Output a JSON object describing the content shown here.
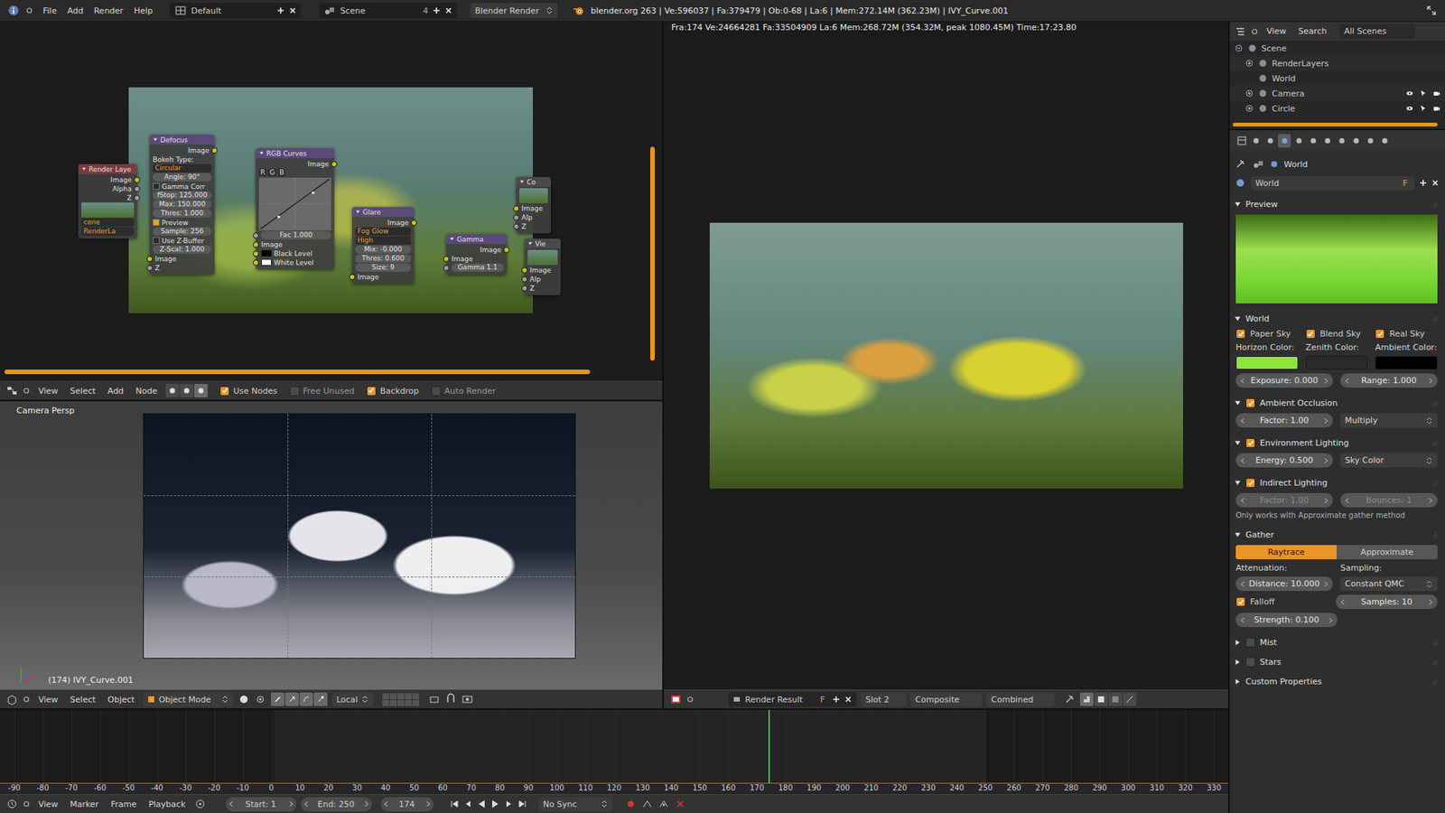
{
  "top_bar": {
    "menus": [
      "File",
      "Add",
      "Render",
      "Help"
    ],
    "screen_layout": "Default",
    "scene": "Scene",
    "scene_users": "4",
    "render_engine": "Blender Render",
    "stats": "blender.org 263 | Ve:596037 | Fa:379479 | Ob:0-68 | La:6 | Mem:272.14M (362.23M) | IVY_Curve.001"
  },
  "node_editor": {
    "nodes": [
      {
        "title": "Render Laye",
        "color": "#7a3b3b",
        "rows": [
          {
            "kind": "output",
            "text": "Image",
            "socket": "color"
          },
          {
            "kind": "output",
            "text": "Alpha",
            "socket": "value"
          },
          {
            "kind": "output",
            "text": "Z",
            "socket": "value"
          },
          {
            "kind": "thumb"
          },
          {
            "kind": "option",
            "text": "cene"
          },
          {
            "kind": "option",
            "text": "RenderLa"
          }
        ]
      },
      {
        "title": "Defocus",
        "color": "#5b4a7a",
        "rows": [
          {
            "kind": "output",
            "text": "Image",
            "socket": "color"
          },
          {
            "kind": "label",
            "text": "Bokeh Type:"
          },
          {
            "kind": "option",
            "text": "Circular"
          },
          {
            "kind": "field",
            "text": "Angle: 90°"
          },
          {
            "kind": "check",
            "text": "Gamma Corr",
            "checked": false
          },
          {
            "kind": "field",
            "text": "fStop: 125.000"
          },
          {
            "kind": "field",
            "text": "Max: 150.000"
          },
          {
            "kind": "field",
            "text": "Thres: 1.000"
          },
          {
            "kind": "check",
            "text": "Preview",
            "checked": true
          },
          {
            "kind": "field",
            "text": "Sample: 256"
          },
          {
            "kind": "check",
            "text": "Use Z-Buffer",
            "checked": false
          },
          {
            "kind": "field",
            "text": "Z-Scal: 1.000"
          },
          {
            "kind": "input",
            "text": "Image",
            "socket": "color"
          },
          {
            "kind": "input",
            "text": "Z",
            "socket": "value"
          }
        ]
      },
      {
        "title": "RGB Curves",
        "color": "#5b4a7a",
        "rows": [
          {
            "kind": "output",
            "text": "Image",
            "socket": "color"
          },
          {
            "kind": "curve",
            "channels": [
              "R",
              "G",
              "B"
            ]
          },
          {
            "kind": "input-field",
            "text": "Fac 1.000",
            "socket": "value"
          },
          {
            "kind": "input",
            "text": "Image",
            "socket": "color"
          },
          {
            "kind": "color-input",
            "text": "Black Level",
            "color": "#000000",
            "socket": "color"
          },
          {
            "kind": "color-input",
            "text": "White Level",
            "color": "#ffffff",
            "socket": "color"
          }
        ]
      },
      {
        "title": "Glare",
        "color": "#5b4a7a",
        "rows": [
          {
            "kind": "output",
            "text": "Image",
            "socket": "color"
          },
          {
            "kind": "option",
            "text": "Fog Glow"
          },
          {
            "kind": "option",
            "text": "High"
          },
          {
            "kind": "field",
            "text": "Mix: -0.000"
          },
          {
            "kind": "field",
            "text": "Thres: 0.600"
          },
          {
            "kind": "field",
            "text": "Size: 9"
          },
          {
            "kind": "input",
            "text": "Image",
            "socket": "color"
          }
        ]
      },
      {
        "title": "Gamma",
        "color": "#5b4a7a",
        "rows": [
          {
            "kind": "output",
            "text": "Image",
            "socket": "color"
          },
          {
            "kind": "input",
            "text": "Image",
            "socket": "color"
          },
          {
            "kind": "input-field",
            "text": "Gamma 1.1",
            "socket": "value"
          }
        ]
      },
      {
        "title": "Co",
        "color": "#4a4a4a",
        "rows": [
          {
            "kind": "thumb"
          },
          {
            "kind": "input",
            "text": "Image",
            "socket": "color"
          },
          {
            "kind": "input",
            "text": "Alp",
            "socket": "value"
          },
          {
            "kind": "input",
            "text": "Z",
            "socket": "value"
          }
        ]
      },
      {
        "title": "Vie",
        "color": "#4a4a4a",
        "rows": [
          {
            "kind": "thumb"
          },
          {
            "kind": "input",
            "text": "Image",
            "socket": "color"
          },
          {
            "kind": "input",
            "text": "Alp",
            "socket": "value"
          },
          {
            "kind": "input",
            "text": "Z",
            "socket": "value"
          }
        ]
      }
    ],
    "header": {
      "menus": [
        "View",
        "Select",
        "Add",
        "Node"
      ],
      "tree_types": [
        {
          "selected": false
        },
        {
          "selected": false
        },
        {
          "selected": true
        }
      ],
      "toggles": [
        {
          "label": "Use Nodes",
          "checked": true
        },
        {
          "label": "Free Unused",
          "checked": false
        },
        {
          "label": "Backdrop",
          "checked": true
        },
        {
          "label": "Auto Render",
          "checked": false
        }
      ]
    }
  },
  "view3d": {
    "overlay_title": "Camera Persp",
    "object_info": "(174) IVY_Curve.001",
    "header": {
      "menus": [
        "View",
        "Select",
        "Object"
      ],
      "mode": "Object Mode",
      "orientation": "Local"
    }
  },
  "image_editor": {
    "info": "Fra:174 Ve:24664281 Fa:33504909 La:6 Mem:268.72M (354.32M, peak 1080.45M) Time:17:23.80",
    "header": {
      "image": "Render Result",
      "fake_user": "F",
      "slot": "Slot 2",
      "layer": "Composite",
      "pass": "Combined"
    }
  },
  "timeline": {
    "ruler": [
      "-90",
      "-80",
      "-70",
      "-60",
      "-50",
      "-40",
      "-30",
      "-20",
      "-10",
      "0",
      "10",
      "20",
      "30",
      "40",
      "50",
      "60",
      "70",
      "80",
      "90",
      "100",
      "110",
      "120",
      "130",
      "140",
      "150",
      "160",
      "170",
      "180",
      "190",
      "200",
      "210",
      "220",
      "230",
      "240",
      "250",
      "260",
      "270",
      "280",
      "290",
      "300",
      "310",
      "320",
      "330"
    ],
    "current_frame": "174",
    "header": {
      "menus": [
        "View",
        "Marker",
        "Frame",
        "Playback"
      ],
      "start": {
        "label": "Start:",
        "value": "1"
      },
      "end": {
        "label": "End:",
        "value": "250"
      },
      "frame": "174",
      "sync": "No Sync"
    }
  },
  "outliner": {
    "menus": [
      "View",
      "Search"
    ],
    "filter": "All Scenes",
    "items": [
      {
        "name": "Scene",
        "depth": 0,
        "expandable": true,
        "expanded": true,
        "restrict": false
      },
      {
        "name": "RenderLayers",
        "depth": 1,
        "expandable": true,
        "expanded": false,
        "restrict": false
      },
      {
        "name": "World",
        "depth": 1,
        "expandable": false,
        "expanded": false,
        "restrict": false
      },
      {
        "name": "Camera",
        "depth": 1,
        "expandable": true,
        "expanded": false,
        "restrict": true
      },
      {
        "name": "Circle",
        "depth": 1,
        "expandable": true,
        "expanded": false,
        "restrict": true
      }
    ]
  },
  "properties": {
    "tabs": [
      {
        "selected": false
      },
      {
        "selected": false
      },
      {
        "selected": true
      },
      {
        "selected": false
      },
      {
        "selected": false
      },
      {
        "selected": false
      },
      {
        "selected": false
      },
      {
        "selected": false
      },
      {
        "selected": false
      },
      {
        "selected": false
      }
    ],
    "breadcrumb": "World",
    "datablock": {
      "name": "World",
      "fake_user": "F"
    },
    "panels": [
      {
        "title": "Preview",
        "kind": "plain",
        "checked": false,
        "expanded": true,
        "rows": [
          [
            {
              "kind": "preview",
              "disabled": false
            }
          ]
        ]
      },
      {
        "title": "World",
        "kind": "plain",
        "checked": false,
        "expanded": true,
        "rows": [
          [
            {
              "kind": "check",
              "text": "Paper Sky",
              "checked": true,
              "disabled": false
            },
            {
              "kind": "check",
              "text": "Blend Sky",
              "checked": true,
              "disabled": false
            },
            {
              "kind": "check",
              "text": "Real Sky",
              "checked": true,
              "disabled": false
            }
          ],
          [
            {
              "kind": "label",
              "text": "Horizon Color:",
              "disabled": false
            },
            {
              "kind": "label",
              "text": "Zenith Color:",
              "disabled": false
            },
            {
              "kind": "label",
              "text": "Ambient Color:",
              "disabled": false
            }
          ],
          [
            {
              "kind": "color",
              "color": "#8ee43c",
              "disabled": false
            },
            {
              "kind": "color",
              "color": "#2a2a2a",
              "disabled": false
            },
            {
              "kind": "color",
              "color": "#000000",
              "disabled": false
            }
          ],
          [
            {
              "kind": "number",
              "text": "Exposure: 0.000",
              "disabled": false
            },
            {
              "kind": "number",
              "text": "Range: 1.000",
              "disabled": false
            }
          ]
        ]
      },
      {
        "title": "Ambient Occlusion",
        "kind": "toggle",
        "checked": true,
        "expanded": true,
        "rows": [
          [
            {
              "kind": "number",
              "text": "Factor: 1.00",
              "disabled": false
            },
            {
              "kind": "menu",
              "text": "Multiply",
              "disabled": false
            }
          ]
        ]
      },
      {
        "title": "Environment Lighting",
        "kind": "toggle",
        "checked": true,
        "expanded": true,
        "rows": [
          [
            {
              "kind": "number",
              "text": "Energy: 0.500",
              "disabled": false
            },
            {
              "kind": "menu",
              "text": "Sky Color",
              "disabled": false
            }
          ]
        ]
      },
      {
        "title": "Indirect Lighting",
        "kind": "toggle",
        "checked": true,
        "expanded": true,
        "rows": [
          [
            {
              "kind": "number",
              "text": "Factor: 1.00",
              "disabled": true
            },
            {
              "kind": "number",
              "text": "Bounces: 1",
              "disabled": true
            }
          ],
          [
            {
              "kind": "note",
              "text": "Only works with Approximate gather method",
              "disabled": false
            }
          ]
        ]
      },
      {
        "title": "Gather",
        "kind": "plain",
        "checked": false,
        "expanded": true,
        "rows": [
          [
            {
              "kind": "radio",
              "text": "Raytrace",
              "selected": true,
              "disabled": false
            },
            {
              "kind": "radio",
              "text": "Approximate",
              "selected": false,
              "disabled": false
            }
          ],
          [
            {
              "kind": "label",
              "text": "Attenuation:",
              "disabled": false
            },
            {
              "kind": "label",
              "text": "Sampling:",
              "disabled": false
            }
          ],
          [
            {
              "kind": "number",
              "text": "Distance: 10.000",
              "disabled": false
            },
            {
              "kind": "menu",
              "text": "Constant QMC",
              "disabled": false
            }
          ],
          [
            {
              "kind": "check",
              "text": "Falloff",
              "checked": true,
              "disabled": false
            },
            {
              "kind": "number",
              "text": "Samples: 10",
              "disabled": false
            }
          ],
          [
            {
              "kind": "number",
              "text": "Strength: 0.100",
              "disabled": false
            },
            {
              "kind": "spacer",
              "disabled": false
            }
          ]
        ]
      },
      {
        "title": "Mist",
        "kind": "toggle",
        "checked": false,
        "expanded": false,
        "rows": []
      },
      {
        "title": "Stars",
        "kind": "toggle",
        "checked": false,
        "expanded": false,
        "rows": []
      },
      {
        "title": "Custom Properties",
        "kind": "plain",
        "checked": false,
        "expanded": false,
        "rows": []
      }
    ]
  }
}
